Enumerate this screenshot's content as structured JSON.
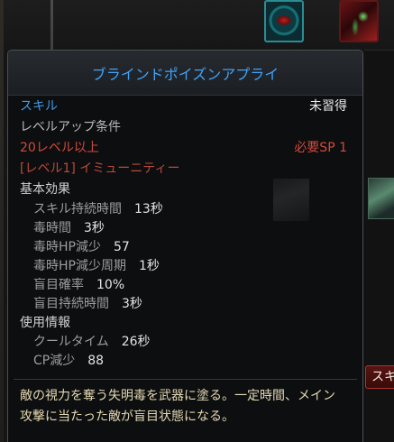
{
  "tooltip": {
    "title": "ブラインドポイズンアプライ",
    "skill_type_label": "スキル",
    "status": "未習得",
    "levelup_heading": "レベルアップ条件",
    "level_requirement": "20レベル以上",
    "sp_requirement": "必要SP 1",
    "prerequisite": "[レベル1] イミューニティー",
    "basic_effects_heading": "基本効果",
    "basic_effects": [
      {
        "label": "スキル持続時間",
        "value": "13秒"
      },
      {
        "label": "毒時間",
        "value": "3秒"
      },
      {
        "label": "毒時HP減少",
        "value": "57"
      },
      {
        "label": "毒時HP減少周期",
        "value": "1秒"
      },
      {
        "label": "盲目確率",
        "value": "10%"
      },
      {
        "label": "盲目持続時間",
        "value": "3秒"
      }
    ],
    "usage_heading": "使用情報",
    "usage": [
      {
        "label": "クールタイム",
        "value": "26秒"
      },
      {
        "label": "CP減少",
        "value": "88"
      }
    ],
    "description_lines": [
      "敵の視力を奪う失明毒を武器に塗る。一定時間、メイン",
      "攻撃に当たった敵が盲目状態になる。"
    ]
  },
  "background": {
    "side_button_label": "スキ",
    "icons": [
      "eye-skill-icon",
      "blade-skill-icon",
      "skill-slot-icon",
      "faded-skill-icon"
    ]
  },
  "colors": {
    "title_blue": "#3fa2f5",
    "type_blue": "#3d9ef0",
    "status_white": "#ececec",
    "heading_grey": "#b9b9b9",
    "section_white": "#d2d2d2",
    "req_red": "#d24a3c",
    "prereq_red": "#ba4a3b",
    "label_grey": "#9d9d9d",
    "value_white": "#e3e3e3",
    "desc_cream": "#e4d8b2"
  }
}
